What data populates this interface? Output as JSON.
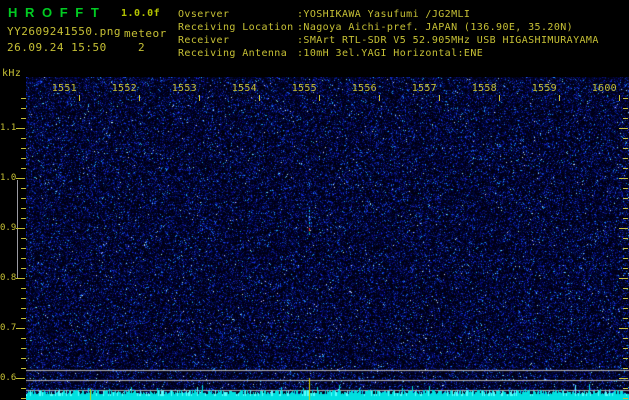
{
  "header": {
    "title": "H R O F F T",
    "version": "1.0.0f",
    "filename": "YY2609241550.png",
    "mode": "meteor",
    "datetime": "26.09.24 15:50",
    "meteor_count": "2",
    "info_rows": [
      {
        "label": "Ovserver",
        "value": ":YOSHIKAWA Yasufumi /JG2MLI"
      },
      {
        "label": "Receiving Location",
        "value": ":Nagoya Aichi-pref. JAPAN (136.90E, 35.20N)"
      },
      {
        "label": "Receiver",
        "value": ":SMArt RTL-SDR V5 52.905MHz USB HIGASHIMURAYAMA"
      },
      {
        "label": "Receiving Antenna",
        "value": ":10mH 3el.YAGI Horizontal:ENE"
      }
    ]
  },
  "axis": {
    "y_unit": "kHz",
    "y_labels": [
      "1.1",
      "1.0",
      "0.9",
      "0.8",
      "0.7",
      "0.6"
    ],
    "x_labels": [
      "1551",
      "1552",
      "1553",
      "1554",
      "1555",
      "1556",
      "1557",
      "1558",
      "1559",
      "1600"
    ]
  },
  "colors": {
    "title_green": "#00cc22",
    "version_green": "#b4c400",
    "text_yellow": "#c6c035",
    "grid_gray": "#b2b2b2",
    "trace_cyan": "#00e0e0",
    "marker_yellow": "#d2d200",
    "echo_red": "#ff3020",
    "echo_teal": "#00b060"
  },
  "chart_data": {
    "type": "heatmap",
    "description": "10-minute VHF meteor-scatter spectrogram; speckled dark-blue noise field on black, no continuous carrier line",
    "x_axis": "time HHMM, one label per minute",
    "x_tick_labels": [
      "1551",
      "1552",
      "1553",
      "1554",
      "1555",
      "1556",
      "1557",
      "1558",
      "1559",
      "1600"
    ],
    "y_unit": "kHz",
    "y_tick_labels": [
      "1.1",
      "1.0",
      "0.9",
      "0.8",
      "0.7",
      "0.6"
    ],
    "y_range_khz": [
      0.56,
      1.16
    ],
    "y_minor_tick_khz": 0.02,
    "horizontal_reference_lines_khz": [
      0.616,
      0.596,
      0.576
    ],
    "meteor_echoes": [
      {
        "near_label": "1555",
        "freq_khz_range": [
          0.89,
          0.945
        ],
        "appearance": "short dotted vertical echo, red peak pixel and teal pixel at base, yellow marker line below"
      },
      {
        "near_label": "1552",
        "appearance": "small yellow marker spike at bottom edge"
      }
    ],
    "bottom_trace": "jagged cyan signal-level trace along bottom edge",
    "grid": "off",
    "legend": "none"
  }
}
